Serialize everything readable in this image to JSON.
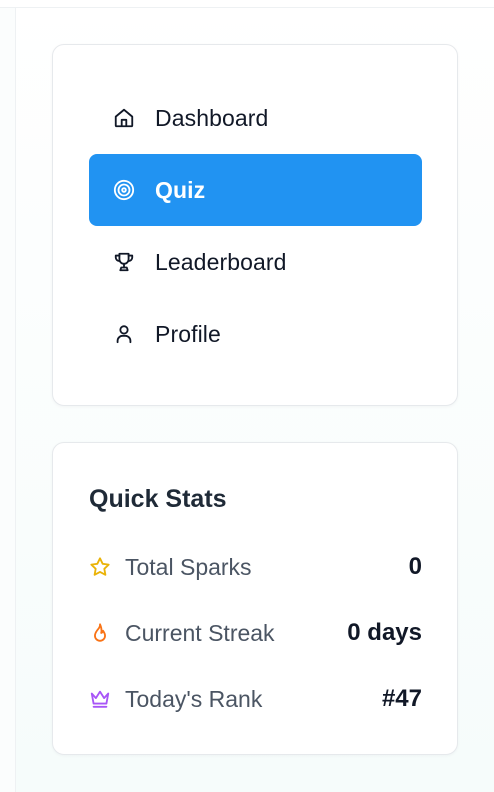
{
  "nav": {
    "items": [
      {
        "label": "Dashboard",
        "icon": "home-icon",
        "active": false
      },
      {
        "label": "Quiz",
        "icon": "target-icon",
        "active": true
      },
      {
        "label": "Leaderboard",
        "icon": "trophy-icon",
        "active": false
      },
      {
        "label": "Profile",
        "icon": "user-icon",
        "active": false
      }
    ]
  },
  "stats": {
    "title": "Quick Stats",
    "rows": [
      {
        "label": "Total Sparks",
        "value": "0",
        "icon": "star-icon",
        "color": "#eab308"
      },
      {
        "label": "Current Streak",
        "value": "0 days",
        "icon": "flame-icon",
        "color": "#f97316"
      },
      {
        "label": "Today's Rank",
        "value": "#47",
        "icon": "crown-icon",
        "color": "#a855f7"
      }
    ]
  },
  "colors": {
    "accent": "#2193f2",
    "text": "#111827",
    "muted": "#4b5563"
  }
}
